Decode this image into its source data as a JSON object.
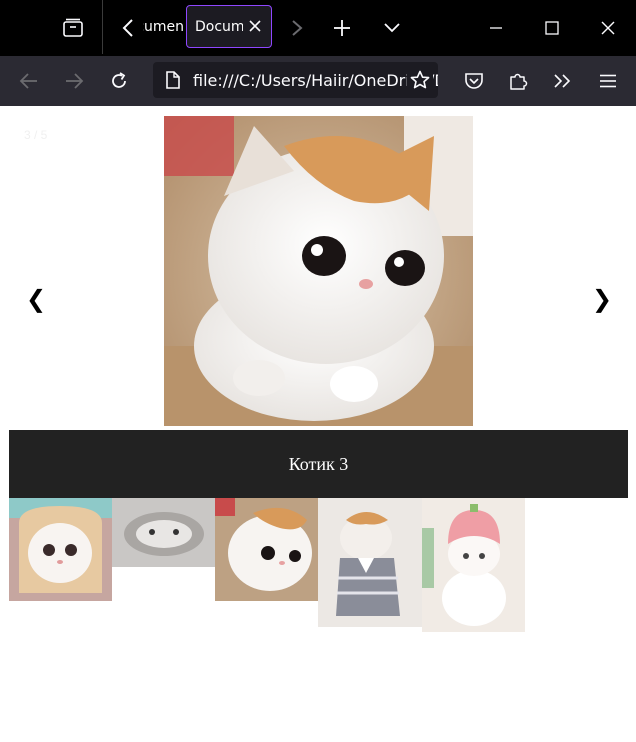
{
  "browser": {
    "inactive_tab_title": "Document",
    "active_tab_title": "Document",
    "url": "file:///C:/Users/Haiir/OneDrive/Desktop/slider/index.html",
    "icons": [
      "tab-list-icon",
      "tabs-scroll-left-icon",
      "tab-close-icon",
      "tabs-scroll-right-icon",
      "new-tab-icon",
      "list-all-tabs-icon",
      "minimize-icon",
      "maximize-icon",
      "window-close-icon",
      "back-icon",
      "forward-icon",
      "reload-icon",
      "page-icon",
      "bookmark-star-icon",
      "pocket-icon",
      "extensions-icon",
      "overflow-icon",
      "menu-icon"
    ]
  },
  "slider": {
    "counter": "3 / 5",
    "prev_label": "❮",
    "next_label": "❯",
    "caption": "Котик 3",
    "current_index": 3,
    "total": 5,
    "thumbnails": [
      "thumbnail-1",
      "thumbnail-2",
      "thumbnail-3",
      "thumbnail-4",
      "thumbnail-5"
    ]
  },
  "colors": {
    "tab_active_border": "#8f47ff",
    "caption_bg": "#222222",
    "toolbar_bg": "#2b2a33",
    "tabbar_bg": "#000000"
  }
}
